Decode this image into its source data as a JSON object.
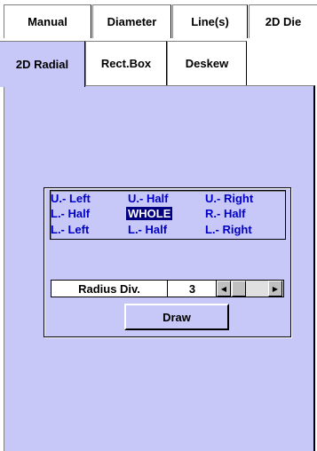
{
  "tabs_row1": [
    {
      "label": "Manual"
    },
    {
      "label": "Diameter"
    },
    {
      "label": "Line(s)"
    },
    {
      "label": "2D Die"
    }
  ],
  "tabs_row2": [
    {
      "label": "2D Radial",
      "active": true
    },
    {
      "label": "Rect.Box"
    },
    {
      "label": "Deskew"
    }
  ],
  "sectors": {
    "rows": [
      [
        "U.- Left",
        "U.- Half",
        "U.- Right"
      ],
      [
        "L.- Half",
        "WHOLE",
        "R.- Half"
      ],
      [
        "L.- Left",
        "L.- Half",
        "L.- Right"
      ]
    ],
    "selected": "WHOLE"
  },
  "radius": {
    "label": "Radius Div.",
    "value": "3"
  },
  "draw_button": {
    "label": "Draw"
  },
  "colors": {
    "panel_bg": "#c8c8f8",
    "sector_text": "#0000c8",
    "selected_bg": "#000080"
  }
}
